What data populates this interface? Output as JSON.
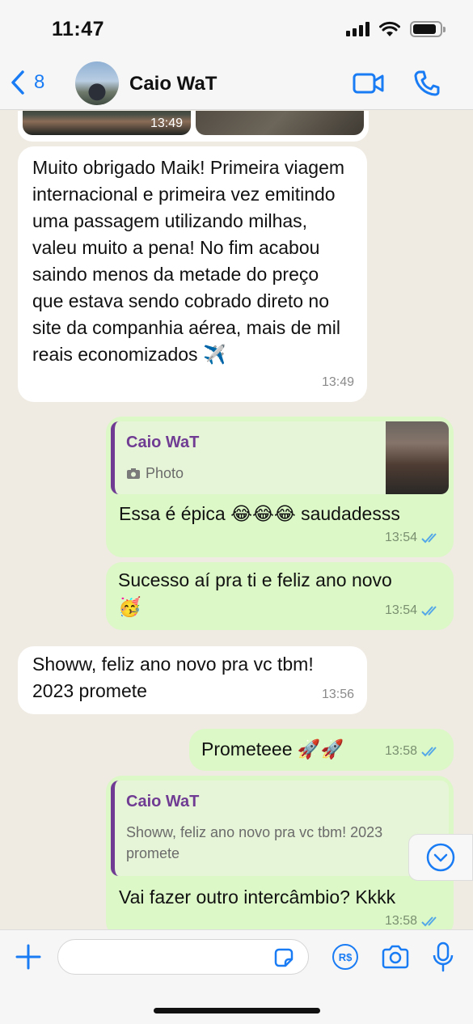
{
  "status": {
    "time": "11:47"
  },
  "header": {
    "back_count": "8",
    "contact_name": "Caio WaT"
  },
  "messages": [
    {
      "id": "img",
      "direction": "in",
      "time": "13:49"
    },
    {
      "id": "m1",
      "direction": "in",
      "text": "Muito obrigado Maik! Primeira viagem internacional e primeira vez emitindo uma passagem utilizando milhas, valeu muito a pena! No fim acabou saindo menos da metade do preço que estava sendo cobrado direto no site da companhia aérea, mais de mil reais economizados ✈️",
      "time": "13:49"
    },
    {
      "id": "m2",
      "direction": "out",
      "quote_name": "Caio WaT",
      "quote_text": "Photo",
      "text": "Essa é épica 😂😂😂 saudadesss",
      "time": "13:54"
    },
    {
      "id": "m3",
      "direction": "out",
      "text": "Sucesso aí pra ti e feliz ano novo 🥳",
      "time": "13:54"
    },
    {
      "id": "m4",
      "direction": "in",
      "text": "Showw, feliz ano novo pra vc tbm! 2023 promete",
      "time": "13:56"
    },
    {
      "id": "m5",
      "direction": "out",
      "text": "Prometeee 🚀🚀",
      "time": "13:58"
    },
    {
      "id": "m6",
      "direction": "out",
      "quote_name": "Caio WaT",
      "quote_text": "Showw, feliz ano novo pra vc tbm! 2023 promete",
      "text": "Vai fazer outro intercâmbio? Kkkk",
      "time": "13:58"
    }
  ],
  "input": {
    "value": "",
    "placeholder": ""
  },
  "colors": {
    "accent": "#1a7cf4",
    "outgoing": "#dbf8c6",
    "incoming": "#ffffff",
    "quote_name": "#6f3b93",
    "read_ticks": "#53a7e8"
  },
  "icons": [
    "back-chevron-icon",
    "video-call-icon",
    "phone-icon",
    "camera-small-icon",
    "read-ticks-icon",
    "chevron-down-icon",
    "plus-icon",
    "sticker-icon",
    "rs-icon",
    "camera-icon",
    "microphone-icon"
  ]
}
